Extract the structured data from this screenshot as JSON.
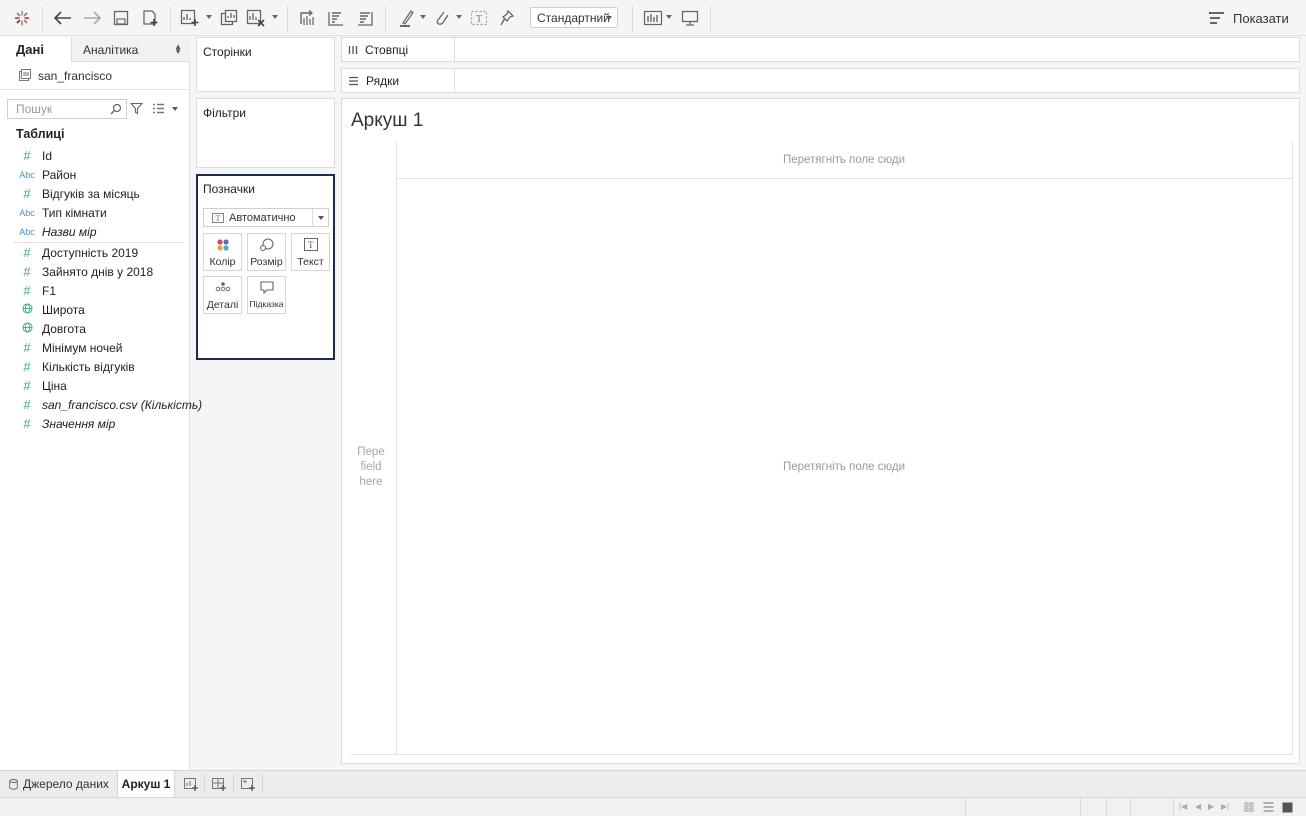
{
  "toolbar": {
    "mark_view_dropdown": "Стандартний",
    "show_me_label": "Показати"
  },
  "data_pane": {
    "tabs": {
      "data": "Дані",
      "analytics": "Аналітика"
    },
    "datasource": "san_francisco",
    "search_placeholder": "Пошук",
    "tables_header": "Таблиці",
    "fields": [
      {
        "type_label": "#",
        "name": "Id"
      },
      {
        "type_label": "Abc",
        "name": "Район"
      },
      {
        "type_label": "#",
        "name": "Відгуків за місяць"
      },
      {
        "type_label": "Abc",
        "name": "Тип кімнати"
      },
      {
        "type_label": "Abc",
        "name": "Назви мір"
      },
      {
        "type_label": "#",
        "name": "Доступність 2019"
      },
      {
        "type_label": "#",
        "name": "Зайнято днів у 2018"
      },
      {
        "type_label": "#",
        "name": "F1"
      },
      {
        "type_label": "globe",
        "name": "Широта"
      },
      {
        "type_label": "globe",
        "name": "Довгота"
      },
      {
        "type_label": "#",
        "name": "Мінімум ночей"
      },
      {
        "type_label": "#",
        "name": "Кількість відгуків"
      },
      {
        "type_label": "#",
        "name": "Ціна"
      },
      {
        "type_label": "#",
        "name": "san_francisco.csv (Кількість)"
      },
      {
        "type_label": "#",
        "name": "Значення мір"
      }
    ]
  },
  "cards": {
    "pages": "Сторінки",
    "filters": "Фільтри",
    "marks": {
      "title": "Позначки",
      "mark_type": "Автоматично",
      "buttons": {
        "color": "Колір",
        "size": "Розмір",
        "text": "Текст",
        "detail": "Деталі",
        "tooltip": "Підказка"
      }
    }
  },
  "shelves": {
    "columns": "Стовпці",
    "rows": "Рядки"
  },
  "viz": {
    "sheet_title": "Аркуш 1",
    "drop_field_top": "Перетягніть поле сюди",
    "drop_field_center": "Перетягніть поле сюди",
    "drop_field_left_1": "Пере",
    "drop_field_left_2": "field",
    "drop_field_left_3": "here"
  },
  "sheet_tabs": {
    "datasource": "Джерело даних",
    "sheet1": "Аркуш 1"
  },
  "colors": {
    "marks_card_border": "#1f2d4d",
    "measure_icon": "#3fa88a",
    "dimension_icon": "#4a90c8",
    "logo_orange": "#e8762d"
  }
}
